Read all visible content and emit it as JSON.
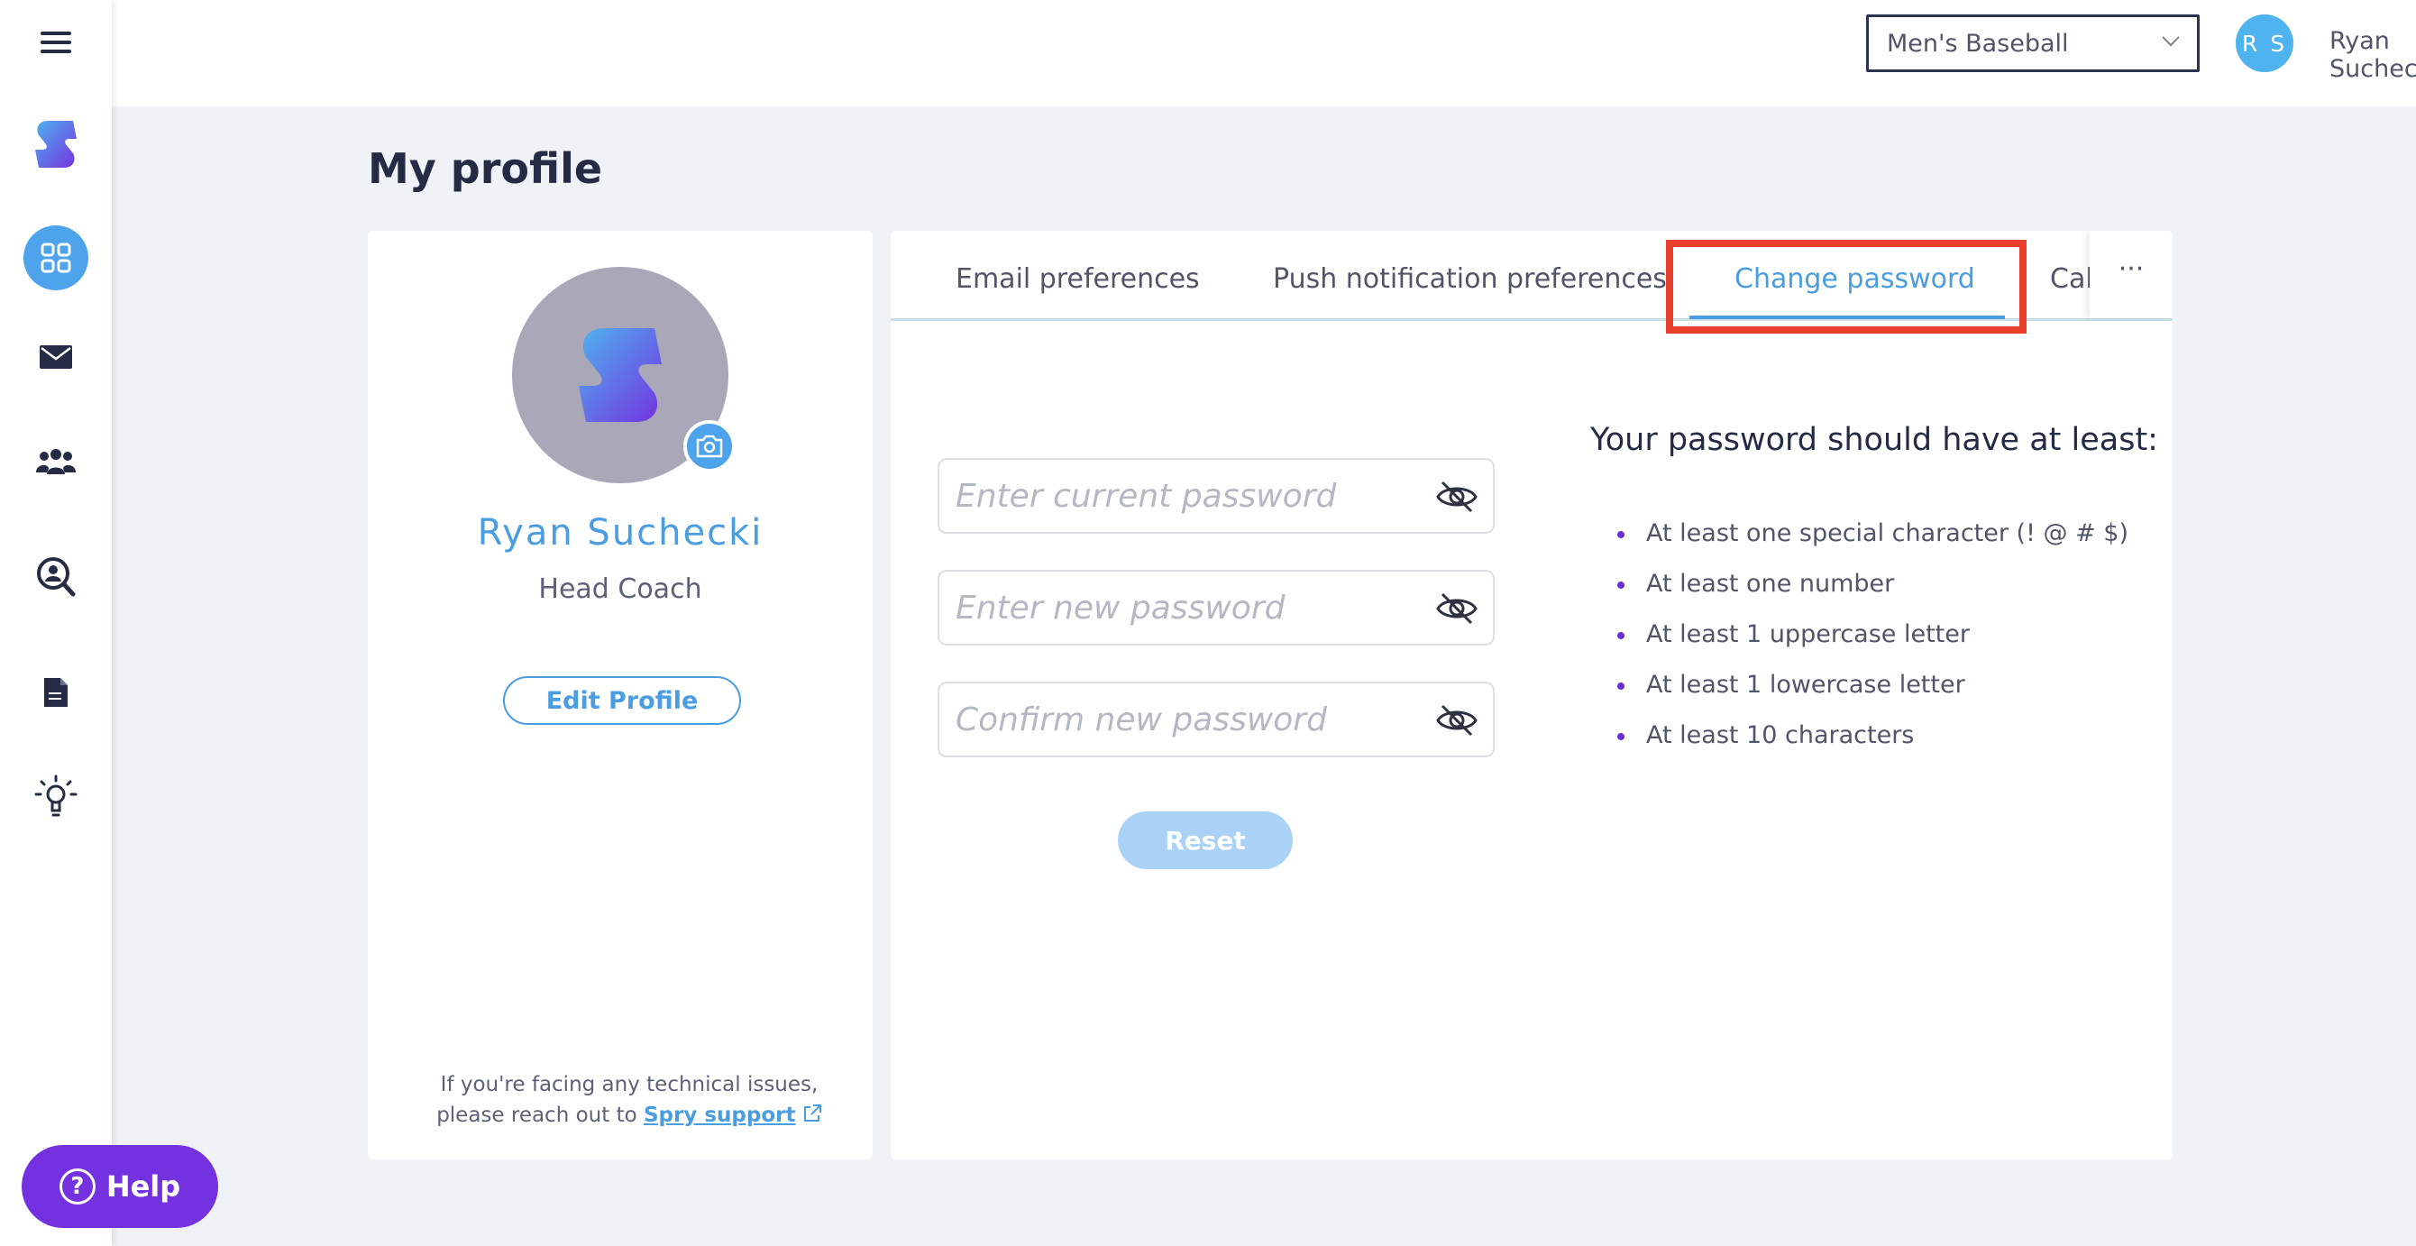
{
  "app": {
    "colors": {
      "accent": "#4a9de0",
      "primary_dark": "#262b45",
      "help_purple": "#7431e0",
      "highlight_red": "#e8402a",
      "reset_disabled": "#a9d2f6"
    }
  },
  "sidebar": {
    "items": [
      {
        "icon": "hamburger-menu-icon"
      },
      {
        "icon": "spry-logo-icon"
      },
      {
        "icon": "dashboard-grid-icon",
        "active": true
      },
      {
        "icon": "mail-icon"
      },
      {
        "icon": "team-icon"
      },
      {
        "icon": "search-user-icon"
      },
      {
        "icon": "document-icon"
      },
      {
        "icon": "lightbulb-icon"
      }
    ]
  },
  "topbar": {
    "team_selected": "Men's Baseball",
    "avatar_initials": "R S",
    "user_name": "Ryan Suchecki"
  },
  "page": {
    "title": "My profile"
  },
  "profile": {
    "name": "Ryan Suchecki",
    "role": "Head Coach",
    "edit_label": "Edit Profile",
    "support_line1": "If you're facing any technical issues,",
    "support_line2": "please reach out to",
    "support_link": "Spry support"
  },
  "tabs": {
    "email": "Email preferences",
    "push": "Push notification preferences",
    "change_password": "Change password",
    "cal": "Cal",
    "more": "···",
    "active": "change_password"
  },
  "password_form": {
    "current_placeholder": "Enter current password",
    "new_placeholder": "Enter new password",
    "confirm_placeholder": "Confirm new password",
    "reset_label": "Reset"
  },
  "requirements": {
    "title": "Your password should have at least:",
    "items": [
      "At least one special character (! @ # $)",
      "At least one number",
      "At least 1 uppercase letter",
      "At least 1 lowercase letter",
      "At least 10 characters"
    ]
  },
  "help": {
    "label": "Help"
  }
}
